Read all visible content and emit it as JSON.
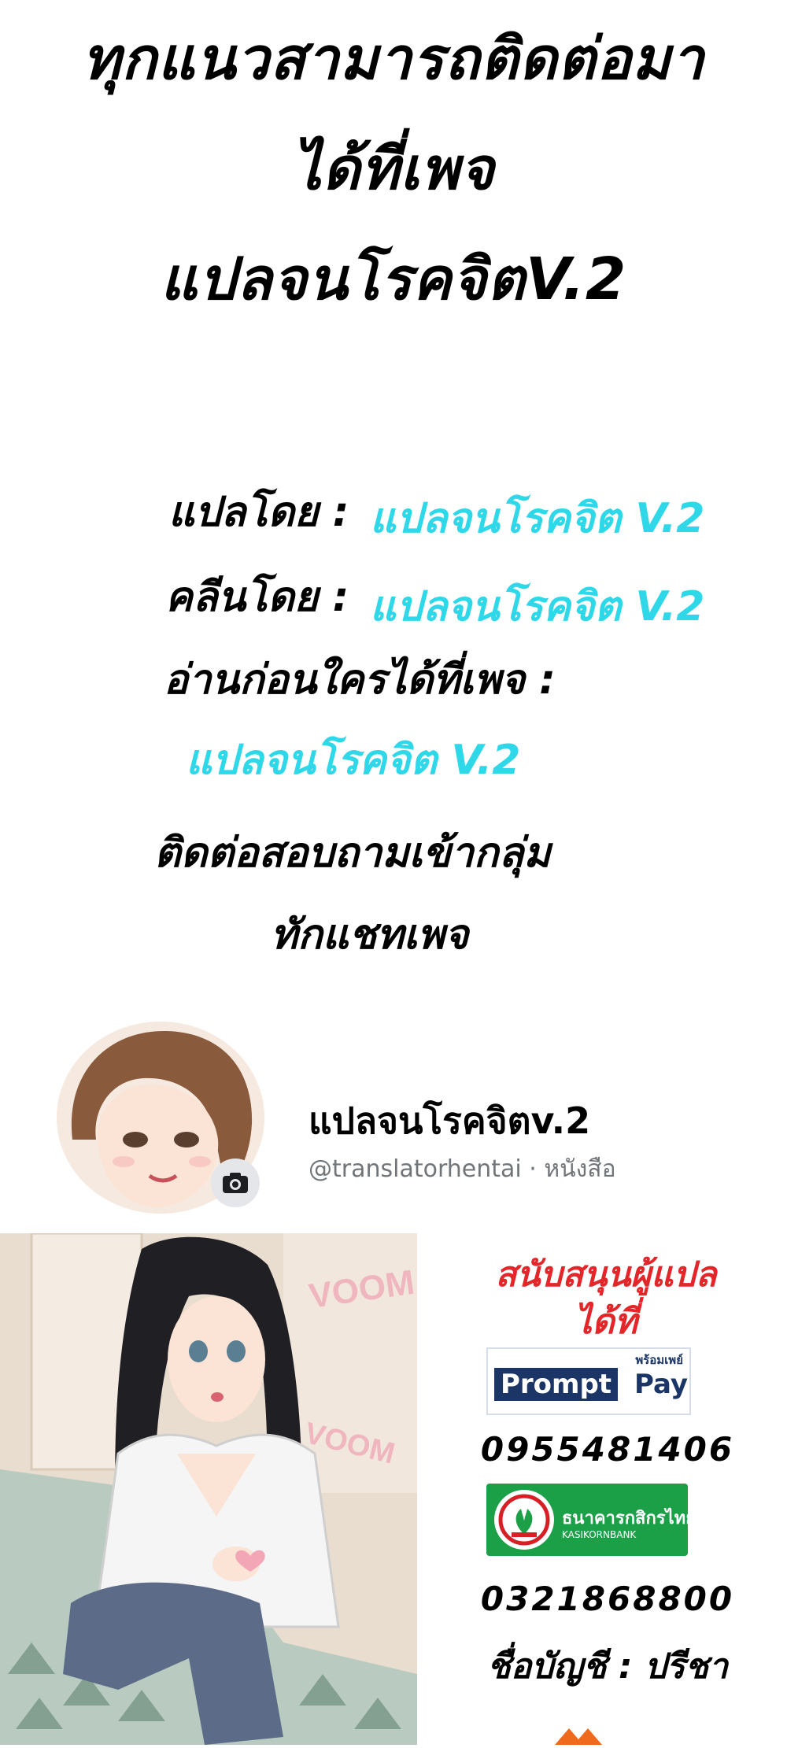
{
  "header": {
    "line1": "ทุกแนวสามารถติดต่อมา",
    "line2": "ได้ที่เพจ",
    "line3": "แปลจนโรคจิตV.2"
  },
  "credits": {
    "translated_label": "แปลโดย :",
    "translated_value": "แปลจนโรคจิต V.2",
    "cleaned_label": "คลีนโดย :",
    "cleaned_value": "แปลจนโรคจิต V.2",
    "read_first_label": "อ่านก่อนใครได้ที่เพจ :",
    "read_first_value": "แปลจนโรคจิต V.2",
    "contact_line1": "ติดต่อสอบถามเข้ากลุ่ม",
    "contact_line2": "ทักแชทเพจ"
  },
  "profile": {
    "name": "แปลจนโรคจิตv.2",
    "handle": "@translatorhentai · หนังสือ",
    "camera_icon": "camera-icon"
  },
  "support": {
    "title_line1": "สนับสนุนผู้แปล",
    "title_line2": "ได้ที่",
    "promptpay_small": "พร้อมเพย์",
    "promptpay_prompt": "Prompt",
    "promptpay_pay": "Pay",
    "promptpay_number": "0955481406",
    "bank_name_th": "ธนาคารกสิกรไทย",
    "bank_name_en": "KASIKORNBANK",
    "bank_number": "0321868800",
    "account_name": "ชื่อบัญชี : ปรีชา"
  },
  "illustration": {
    "sfx_1": "VOOM",
    "sfx_2": "VOOM"
  },
  "colors": {
    "accent_cyan": "#2fd8e8",
    "support_red": "#e3262a",
    "promptpay_navy": "#1a3566",
    "kbank_green": "#1b9f47"
  }
}
